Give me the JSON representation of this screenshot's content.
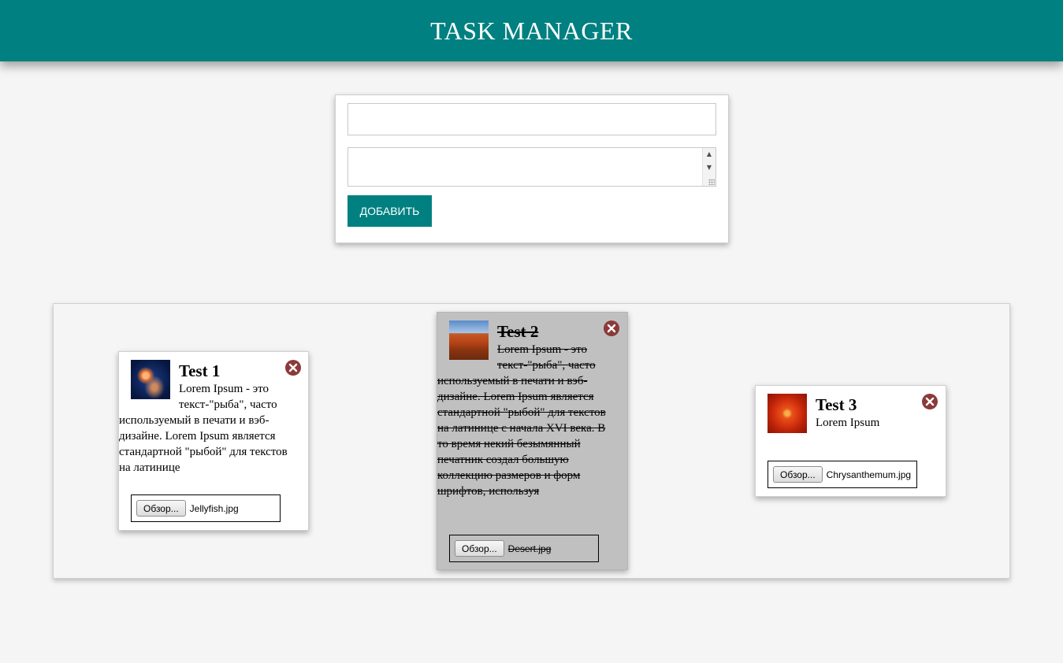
{
  "header": {
    "title": "TASK MANAGER"
  },
  "form": {
    "title_value": "",
    "title_placeholder": "",
    "description_value": "",
    "description_placeholder": "",
    "add_button_label": "ДОБАВИТЬ"
  },
  "tasks": [
    {
      "title": "Test 1",
      "description": "Lorem Ipsum - это текст-\"рыба\", часто используемый в печати и вэб-дизайне. Lorem Ipsum является стандартной \"рыбой\" для текстов на латинице",
      "browse_label": "Обзор...",
      "file_name": "Jellyfish.jpg",
      "completed": false,
      "image_icon": "jellyfish-image"
    },
    {
      "title": "Test 2",
      "description": "Lorem Ipsum - это текст-\"рыба\", часто используемый в печати и вэб-дизайне. Lorem Ipsum является стандартной \"рыбой\" для текстов на латинице с начала XVI века. В то время некий безымянный печатник создал большую коллекцию размеров и форм шрифтов, используя",
      "browse_label": "Обзор...",
      "file_name": "Desert.jpg",
      "completed": true,
      "image_icon": "desert-image"
    },
    {
      "title": "Test 3",
      "description": "Lorem Ipsum",
      "browse_label": "Обзор...",
      "file_name": "Chrysanthemum.jpg",
      "completed": false,
      "image_icon": "chrysanthemum-image"
    }
  ],
  "colors": {
    "accent": "#008080",
    "page_background": "#f5f5f5",
    "completed_card": "#c0c0c0",
    "delete_icon": "#8b3a3a"
  }
}
